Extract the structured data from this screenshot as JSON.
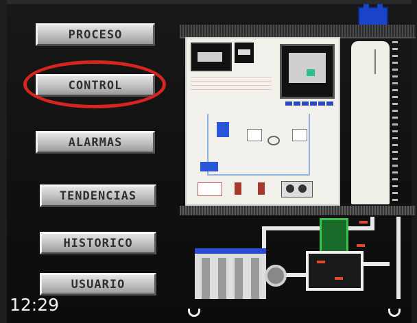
{
  "menu": {
    "proceso": "PROCESO",
    "control": "CONTROL",
    "alarmas": "ALARMAS",
    "tendencias": "TENDENCIAS",
    "historico": "HISTORICO",
    "usuario": "USUARIO"
  },
  "status": {
    "time": "12:29"
  },
  "colors": {
    "highlight_ring": "#d6241e",
    "button_face": "#c4c4c4",
    "background": "#141414",
    "equipment_blue": "#2a55d6"
  },
  "icons": {
    "nav_prev": "nav-back-arrow-icon",
    "nav_next": "nav-next-arrow-icon",
    "plc": "plc-module-icon"
  }
}
